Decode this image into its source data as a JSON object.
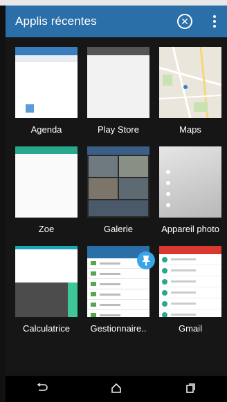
{
  "header": {
    "title": "Applis récentes",
    "close_icon": "close-circle-icon",
    "more_icon": "more-vert-icon",
    "color": "#2b6fa8"
  },
  "apps": [
    {
      "label": "Agenda"
    },
    {
      "label": "Play Store"
    },
    {
      "label": "Maps"
    },
    {
      "label": "Zoe"
    },
    {
      "label": "Galerie"
    },
    {
      "label": "Appareil photo"
    },
    {
      "label": "Calculatrice"
    },
    {
      "label": "Gestionnaire.."
    },
    {
      "label": "Gmail"
    }
  ],
  "navbar": {
    "back_icon": "back-icon",
    "home_icon": "home-icon",
    "recents_icon": "recents-icon"
  }
}
